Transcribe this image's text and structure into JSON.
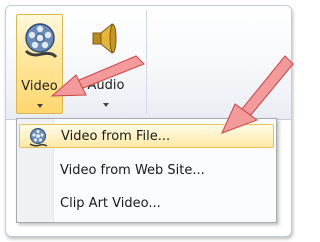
{
  "ribbon": {
    "video_button": {
      "label": "Video",
      "icon": "film-reel-icon"
    },
    "audio_button": {
      "label": "Audio",
      "icon": "speaker-icon"
    }
  },
  "menu": {
    "items": [
      {
        "label": "Video from File...",
        "icon": "film-reel-icon",
        "selected": true
      },
      {
        "label": "Video from Web Site...",
        "icon": "",
        "selected": false
      },
      {
        "label": "Clip Art Video...",
        "icon": "",
        "selected": false
      }
    ]
  },
  "colors": {
    "highlight": "#ffe79b",
    "arrow": "#f28c8c"
  }
}
